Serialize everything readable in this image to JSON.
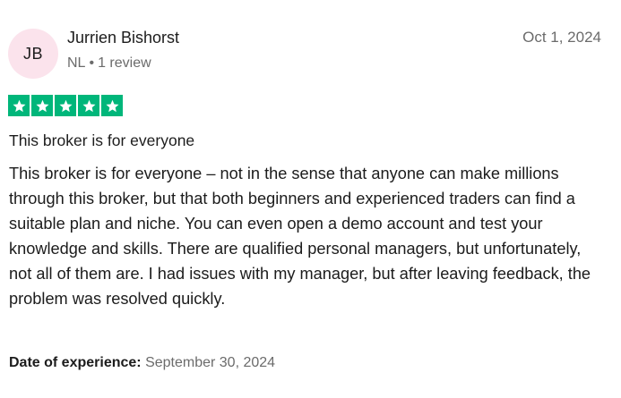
{
  "reviewer": {
    "initials": "JB",
    "name": "Jurrien Bishorst",
    "country": "NL",
    "separator": "•",
    "review_count": "1 review"
  },
  "review": {
    "date": "Oct 1, 2024",
    "rating": 5,
    "star_color": "#00b67a",
    "title": "This broker is for everyone",
    "body": "This broker is for everyone – not in the sense that anyone can make millions through this broker, but that both beginners and experienced traders can find a suitable plan and niche. You can even open a demo account and test your knowledge and skills. There are qualified personal managers, but unfortunately, not all of them are. I had issues with my manager, but after leaving feedback, the problem was resolved quickly.",
    "experience_label": "Date of experience:",
    "experience_date": "September 30, 2024"
  },
  "icons": {
    "star": "star-icon"
  },
  "colors": {
    "avatar_bg": "#fbe3ec",
    "muted_text": "#6b6b6b"
  }
}
